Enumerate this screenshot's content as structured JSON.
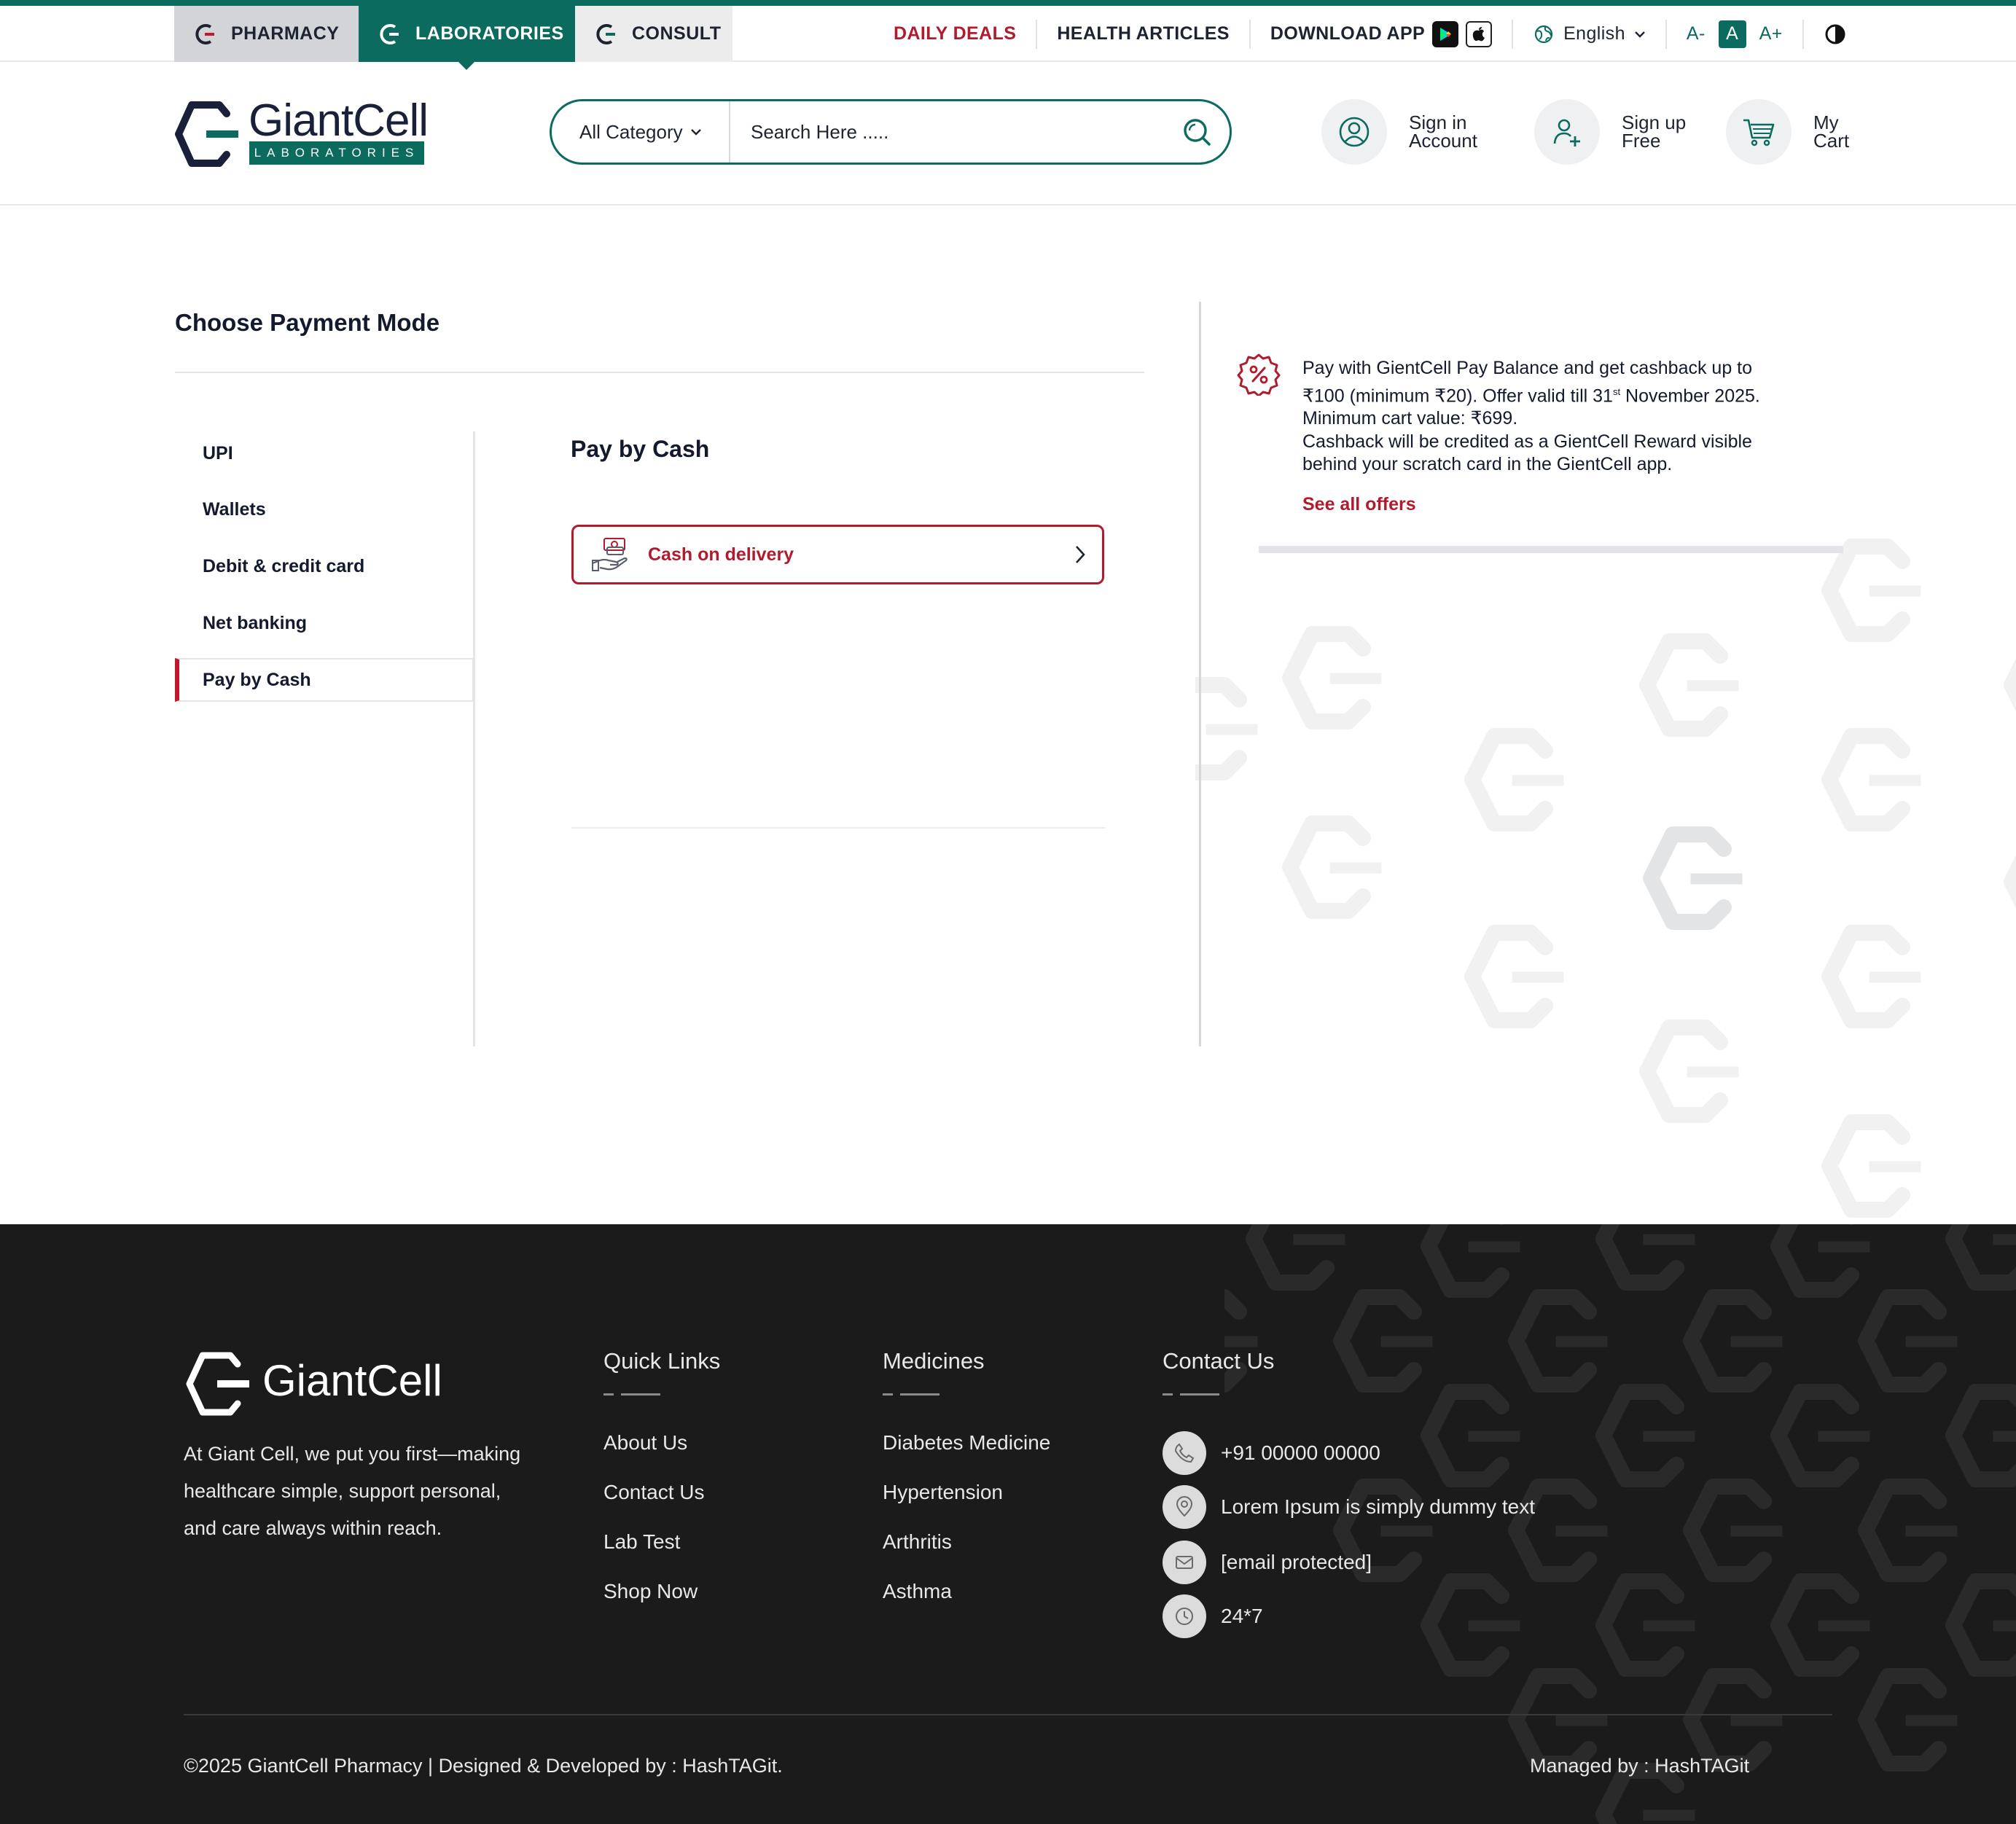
{
  "topnav": {
    "segments": [
      {
        "label": "PHARMACY"
      },
      {
        "label": "LABORATORIES"
      },
      {
        "label": "CONSULT"
      }
    ],
    "links": {
      "daily_deals": "DAILY DEALS",
      "health_articles": "HEALTH ARTICLES",
      "download_app": "DOWNLOAD APP"
    },
    "language": "English",
    "font_sizes": [
      "A-",
      "A",
      "A+"
    ],
    "active_font_size": "A"
  },
  "header": {
    "logo_name": "GiantCell",
    "logo_sub": "LABORATORIES",
    "search": {
      "category": "All Category",
      "placeholder": "Search Here ....."
    },
    "signin": {
      "line1": "Sign in",
      "line2": "Account"
    },
    "signup": {
      "line1": "Sign up",
      "line2": "Free"
    },
    "cart": {
      "line1": "My",
      "line2": "Cart"
    }
  },
  "payment": {
    "title": "Choose Payment Mode",
    "tabs": [
      {
        "label": "UPI"
      },
      {
        "label": "Wallets"
      },
      {
        "label": "Debit & credit card"
      },
      {
        "label": "Net banking"
      },
      {
        "label": "Pay by Cash"
      }
    ],
    "active_tab": "Pay by Cash",
    "pane_title": "Pay by Cash",
    "option": "Cash on delivery"
  },
  "offer": {
    "line1": "Pay with GientCell Pay Balance and get cashback up to",
    "line2_a": "₹100 (minimum ₹20). Offer valid till 31",
    "line2_sup": "st",
    "line2_b": " November 2025.",
    "line3": "Minimum cart value: ₹699.",
    "line4": "Cashback will be credited as a GientCell Reward visible",
    "line5": "behind your scratch card in the GientCell app.",
    "link": "See all offers"
  },
  "footer": {
    "logo_name": "GiantCell",
    "about": [
      "At Giant Cell, we put you first—making",
      "healthcare simple, support personal,",
      "and care always within reach."
    ],
    "quick_links": {
      "title": "Quick Links",
      "items": [
        "About Us",
        "Contact Us",
        "Lab Test",
        "Shop Now"
      ]
    },
    "medicines": {
      "title": "Medicines",
      "items": [
        "Diabetes Medicine",
        "Hypertension",
        "Arthritis",
        "Asthma"
      ]
    },
    "contact": {
      "title": "Contact Us",
      "phone": "+91 00000 00000",
      "address": "Lorem Ipsum is simply dummy text",
      "email": "[email protected]",
      "hours": "24*7"
    },
    "copyright": "©2025 GiantCell Pharmacy | Designed & Developed by : HashTAGit.",
    "managed": "Managed by : HashTAGit"
  },
  "colors": {
    "brand_green": "#0b6b5e",
    "accent_red": "#b11b2e",
    "footer_bg": "#1b1b1c"
  }
}
